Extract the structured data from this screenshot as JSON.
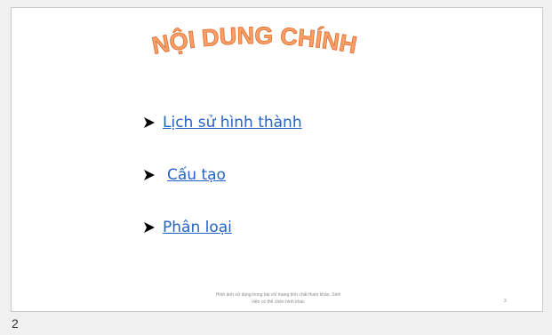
{
  "slide": {
    "title": "NỘI DUNG CHÍNH",
    "title_fill": "#f7a06a",
    "title_outline": "#e26b2a",
    "link_color": "#2563c7",
    "bullet_icon": "arrowhead-bullet-icon",
    "items": [
      {
        "label": "Lịch sử hình thành"
      },
      {
        "label": "Cấu tạo"
      },
      {
        "label": "Phân loại"
      }
    ],
    "footer_line1": "Hình ảnh sử dụng trong bài chỉ mang tính chất tham khảo. Sinh",
    "footer_line2": "viên có thể chèn hình khác",
    "slide_number": "2"
  },
  "thumbnail_caption": "2"
}
